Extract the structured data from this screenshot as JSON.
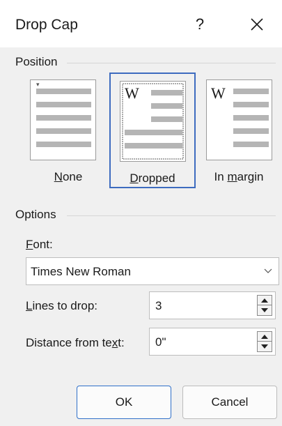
{
  "dialog": {
    "title": "Drop Cap",
    "help_glyph": "?",
    "close_glyph": "X"
  },
  "position": {
    "group_label": "Position",
    "options": [
      {
        "label": "None",
        "mnemonic": "N",
        "selected": false
      },
      {
        "label": "Dropped",
        "mnemonic": "D",
        "selected": true
      },
      {
        "label": "In margin",
        "mnemonic": "m",
        "selected": false
      }
    ],
    "preview_letter": "W"
  },
  "options": {
    "group_label": "Options",
    "font_label": "Font:",
    "font_value": "Times New Roman",
    "lines_label": "Lines to drop:",
    "lines_value": "3",
    "distance_label": "Distance from text:",
    "distance_value": "0\""
  },
  "buttons": {
    "ok": "OK",
    "cancel": "Cancel"
  },
  "colors": {
    "selection_border": "#3d6bbf",
    "ok_border": "#2f6fc9",
    "dialog_bg": "#f0f0f0",
    "titlebar_bg": "#ffffff"
  }
}
